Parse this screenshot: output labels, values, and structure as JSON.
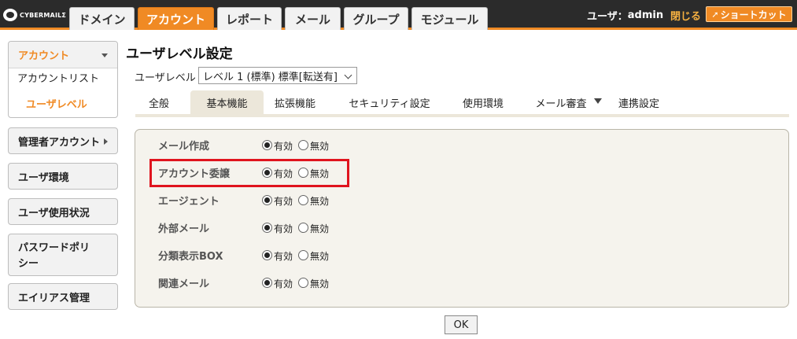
{
  "app": {
    "logo_text": "CYBERMAILΣ"
  },
  "nav": {
    "tabs": [
      "ドメイン",
      "アカウント",
      "レポート",
      "メール",
      "グループ",
      "モジュール"
    ],
    "active_index": 1
  },
  "header": {
    "user_prefix": "ユーザ：",
    "user_name": "admin",
    "close_label": "閉じる",
    "shortcut_label": "ショートカット"
  },
  "sidebar": {
    "group_title": "アカウント",
    "sub_items": [
      "アカウントリスト",
      "ユーザレベル"
    ],
    "active_sub": 1,
    "buttons": [
      "管理者アカウント",
      "ユーザ環境",
      "ユーザ使用状況",
      "パスワードポリシー",
      "エイリアス管理"
    ],
    "buttons_with_arrow": [
      "管理者アカウント"
    ]
  },
  "main": {
    "page_title": "ユーザレベル設定",
    "level_label": "ユーザレベル",
    "level_selected": "レベル 1 (標準) 標準[転送有]",
    "subtabs": [
      "全般",
      "基本機能",
      "拡張機能",
      "セキュリティ設定",
      "使用環境",
      "メール審査",
      "連携設定"
    ],
    "active_subtab": 1,
    "settings": [
      {
        "label": "メール作成",
        "enabled": true
      },
      {
        "label": "アカウント委譲",
        "enabled": true
      },
      {
        "label": "エージェント",
        "enabled": true
      },
      {
        "label": "外部メール",
        "enabled": true
      },
      {
        "label": "分類表示BOX",
        "enabled": true
      },
      {
        "label": "関連メール",
        "enabled": true
      }
    ],
    "radio_enabled_label": "有効",
    "radio_disabled_label": "無効",
    "highlighted_setting": "アカウント委譲",
    "ok_label": "OK"
  },
  "colors": {
    "accent": "#f08a24",
    "topbar": "#2b2b2b",
    "highlight": "#e0141e",
    "panel": "#f5f3ed"
  }
}
